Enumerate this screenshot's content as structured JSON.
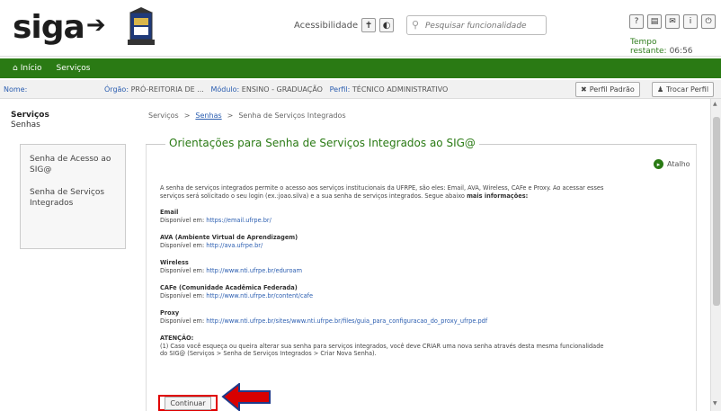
{
  "header": {
    "logo_text": "sig",
    "logo_suffix": "a",
    "accessibility_label": "Acessibilidade",
    "search_placeholder": "Pesquisar funcionalidade",
    "time_label": "Tempo restante:",
    "time_value": "06:56"
  },
  "menu": {
    "home": "Início",
    "services": "Serviços"
  },
  "infobar": {
    "nome_label": "Nome:",
    "orgao_label": "Órgão:",
    "orgao_value": "PRÓ-REITORIA DE ...",
    "modulo_label": "Módulo:",
    "modulo_value": "ENSINO - GRADUAÇÃO",
    "perfil_label": "Perfil:",
    "perfil_value": "TÉCNICO ADMINISTRATIVO",
    "perfil_padrao": "Perfil Padrão",
    "trocar_perfil": "Trocar Perfil"
  },
  "sidebar": {
    "title": "Serviços",
    "subtitle": "Senhas",
    "items": [
      "Senha de Acesso ao SIG@",
      "Senha de Serviços Integrados"
    ]
  },
  "breadcrumb": {
    "items": [
      "Serviços",
      "Senhas",
      "Senha de Serviços Integrados"
    ]
  },
  "main": {
    "title": "Orientações para Senha de Serviços Integrados ao SIG@",
    "atalho": "Atalho",
    "intro": "A senha de serviços integrados permite o acesso aos serviços institucionais da UFRPE, são eles: Email, AVA, Wireless, CAFe e Proxy. Ao acessar esses serviços será solicitado o seu login (ex.:joao.silva) e a sua senha de serviços integrados. Segue abaixo",
    "intro_more": "mais informações:",
    "sections": [
      {
        "title": "Email",
        "prefix": "Disponível em:",
        "url": "https://email.ufrpe.br/"
      },
      {
        "title": "AVA (Ambiente Virtual de Aprendizagem)",
        "prefix": "Disponível em:",
        "url": "http://ava.ufrpe.br/"
      },
      {
        "title": "Wireless",
        "prefix": "Disponível em:",
        "url": "http://www.nti.ufrpe.br/eduroam"
      },
      {
        "title": "CAFe (Comunidade Acadêmica Federada)",
        "prefix": "Disponível em:",
        "url": "http://www.nti.ufrpe.br/content/cafe"
      },
      {
        "title": "Proxy",
        "prefix": "Disponível em:",
        "url": "http://www.nti.ufrpe.br/sites/www.nti.ufrpe.br/files/guia_para_configuracao_do_proxy_ufrpe.pdf"
      }
    ],
    "attention_title": "ATENÇÃO:",
    "attention_text": "(1) Caso você esqueça ou queira alterar sua senha para serviços integrados, você deve CRIAR uma nova senha através desta mesma funcionalidade do SIG@ (Serviços > Senha de Serviços Integrados > Criar Nova Senha).",
    "continue_button": "Continuar"
  }
}
